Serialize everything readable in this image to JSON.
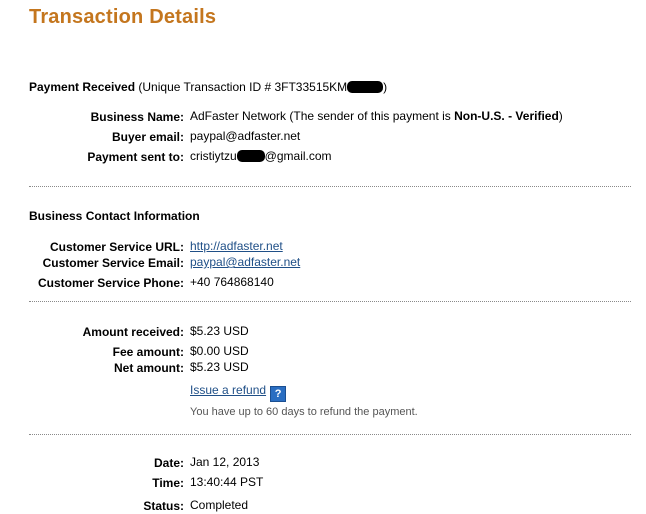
{
  "title": "Transaction Details",
  "payment": {
    "heading": "Payment Received",
    "txn_prefix": " (Unique Transaction ID # 3FT33515KM",
    "txn_suffix": ")"
  },
  "sender": {
    "business_name_label": "Business Name:",
    "business_name_value": "AdFaster Network (The sender of this payment is ",
    "sender_status": "Non-U.S. - Verified",
    "sender_close": ")",
    "buyer_email_label": "Buyer email:",
    "buyer_email_value": "paypal@adfaster.net",
    "sent_to_label": "Payment sent to:",
    "sent_to_prefix": "cristiytzu",
    "sent_to_suffix": "@gmail.com"
  },
  "contact": {
    "heading": "Business Contact Information",
    "url_label": "Customer Service URL:",
    "url_value": "http://adfaster.net",
    "email_label": "Customer Service Email:",
    "email_value": "paypal@adfaster.net",
    "phone_label": "Customer Service Phone:",
    "phone_value": "+40 764868140"
  },
  "amounts": {
    "received_label": "Amount received:",
    "received_value": "$5.23 USD",
    "fee_label": "Fee amount:",
    "fee_value": "$0.00 USD",
    "net_label": "Net amount:",
    "net_value": "$5.23 USD",
    "refund_link": "Issue a refund",
    "help_icon": "?",
    "refund_note": "You have up to 60 days to refund the payment."
  },
  "details": {
    "date_label": "Date:",
    "date_value": "Jan 12, 2013",
    "time_label": "Time:",
    "time_value": "13:40:44 PST",
    "status_label": "Status:",
    "status_value": "Completed"
  },
  "colors": {
    "title": "#c4761e",
    "link": "#1f4f87",
    "help_icon": "#2a6ec2",
    "divider": "#8a8a8a"
  }
}
